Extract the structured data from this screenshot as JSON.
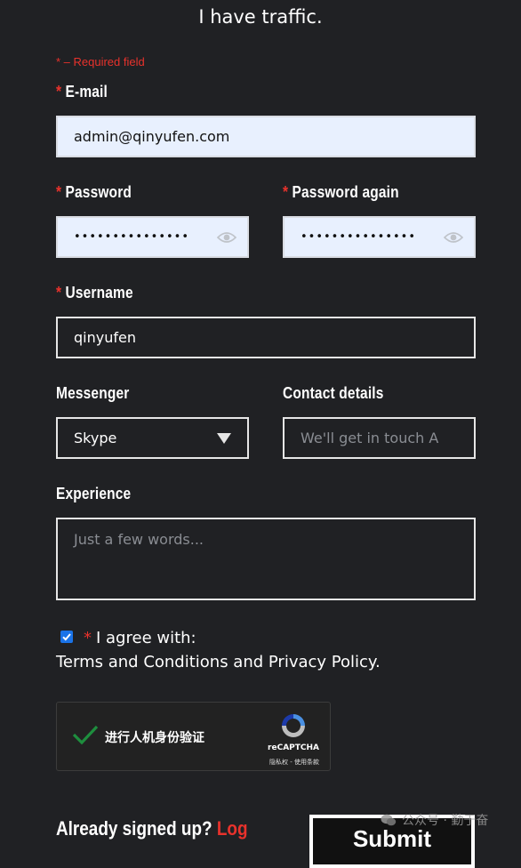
{
  "header": {
    "line2": "I have traffic."
  },
  "form": {
    "required_note": "* – Required field",
    "email": {
      "label": "E-mail",
      "value": "admin@qinyufen.com"
    },
    "password": {
      "label": "Password",
      "value": "•••••••••••••••"
    },
    "password_again": {
      "label": "Password again",
      "value": "•••••••••••••••"
    },
    "username": {
      "label": "Username",
      "value": "qinyufen"
    },
    "messenger": {
      "label": "Messenger",
      "selected": "Skype"
    },
    "contact": {
      "label": "Contact details",
      "placeholder": "We'll get in touch A"
    },
    "experience": {
      "label": "Experience",
      "placeholder": "Just a few words..."
    },
    "agree": {
      "checked": true,
      "line1": "I agree with:",
      "line2": "Terms and Conditions and Privacy Policy."
    },
    "recaptcha": {
      "text": "进行人机身份验证",
      "brand": "reCAPTCHA",
      "terms": "隐私权 - 使用条款"
    },
    "footer": {
      "already": "Already signed up?",
      "log": "Log",
      "submit": "Submit"
    }
  },
  "watermark": {
    "text": "公众号 · 勤于奋"
  },
  "colors": {
    "background": "#202124",
    "accent": "#e8322c",
    "autofill": "#e8f0fe"
  }
}
